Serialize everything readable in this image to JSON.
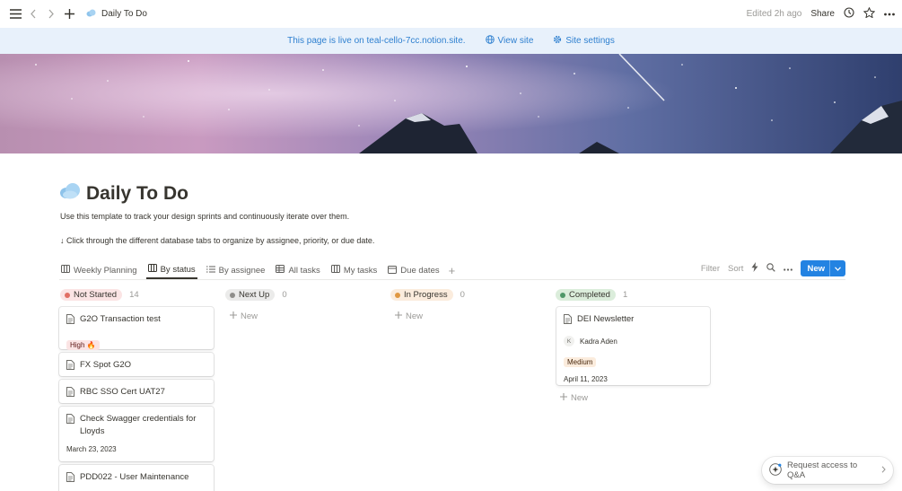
{
  "topbar": {
    "breadcrumb": "Daily To Do",
    "edited": "Edited 2h ago",
    "share": "Share"
  },
  "banner": {
    "message": "This page is live on teal-cello-7cc.notion.site.",
    "view_site": "View site",
    "site_settings": "Site settings"
  },
  "page": {
    "title": "Daily To Do",
    "description": "Use this template to track your design sprints and continuously iterate over them.",
    "hint": "↓ Click through the different database tabs to organize by assignee, priority, or due date."
  },
  "tabs": [
    {
      "label": "Weekly Planning",
      "icon": "board-icon"
    },
    {
      "label": "By status",
      "icon": "board-icon"
    },
    {
      "label": "By assignee",
      "icon": "list-icon"
    },
    {
      "label": "All tasks",
      "icon": "table-icon"
    },
    {
      "label": "My tasks",
      "icon": "board-icon"
    },
    {
      "label": "Due dates",
      "icon": "calendar-icon"
    }
  ],
  "actions": {
    "filter": "Filter",
    "sort": "Sort",
    "new": "New"
  },
  "columns": [
    {
      "name": "Not Started",
      "count": "14",
      "bg": "#fbe4e4",
      "dot": "#e16f64",
      "cards": [
        {
          "title": "G2O Transaction test",
          "tag": "High 🔥"
        },
        {
          "title": "FX Spot G2O"
        },
        {
          "title": "RBC SSO Cert UAT27"
        },
        {
          "title_line1": "Check Swagger credentials for",
          "title_line2": "Lloyds",
          "date": "March 23, 2023"
        },
        {
          "title": "PDD022 - User Maintenance"
        }
      ]
    },
    {
      "name": "Next Up",
      "count": "0",
      "bg": "#ebebea",
      "dot": "#8f8e8b",
      "new": "New"
    },
    {
      "name": "In Progress",
      "count": "0",
      "bg": "#fbecdd",
      "dot": "#e09843",
      "new": "New"
    },
    {
      "name": "Completed",
      "count": "1",
      "bg": "#dbeddb",
      "dot": "#4f9768",
      "new": "New",
      "cards": [
        {
          "title": "DEI Newsletter",
          "assignee_initial": "K",
          "assignee": "Kadra Aden",
          "tag": "Medium",
          "date": "April 11, 2023"
        }
      ]
    }
  ],
  "qa": {
    "label": "Request access to Q&A"
  }
}
